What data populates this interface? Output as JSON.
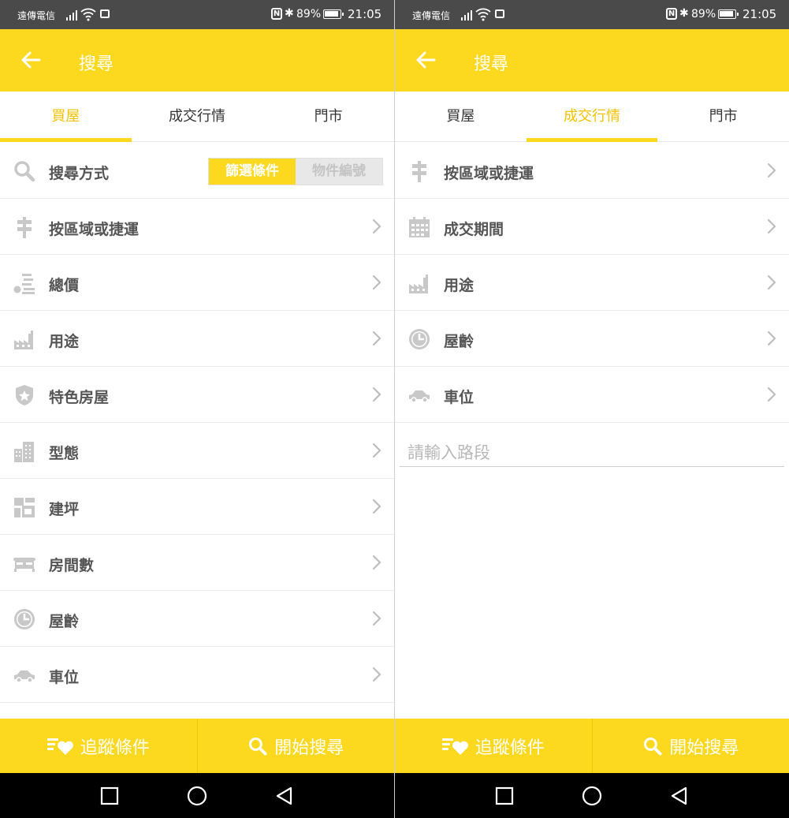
{
  "status_bar": {
    "carrier": "遠傳電信",
    "battery": "89%",
    "time": "21:05"
  },
  "colors": {
    "accent": "#fcd81f",
    "active_tab": "#f2c200",
    "icon_gray": "#c8c8c8"
  },
  "left": {
    "title": "搜尋",
    "tabs": [
      "買屋",
      "成交行情",
      "門市"
    ],
    "active_tab": 0,
    "search_method": {
      "label": "搜尋方式",
      "options": [
        "篩選條件",
        "物件編號"
      ],
      "selected": "篩選條件"
    },
    "rows": [
      {
        "label": "按區域或捷運",
        "icon": "signpost-icon"
      },
      {
        "label": "總價",
        "icon": "money-stack-icon"
      },
      {
        "label": "用途",
        "icon": "factory-icon"
      },
      {
        "label": "特色房屋",
        "icon": "shield-star-icon"
      },
      {
        "label": "型態",
        "icon": "building-icon"
      },
      {
        "label": "建坪",
        "icon": "floorplan-icon"
      },
      {
        "label": "房間數",
        "icon": "bed-icon"
      },
      {
        "label": "屋齡",
        "icon": "clock-icon"
      },
      {
        "label": "車位",
        "icon": "car-icon"
      }
    ],
    "bottom": {
      "track": "追蹤條件",
      "search": "開始搜尋"
    }
  },
  "right": {
    "title": "搜尋",
    "tabs": [
      "買屋",
      "成交行情",
      "門市"
    ],
    "active_tab": 1,
    "rows": [
      {
        "label": "按區域或捷運",
        "icon": "signpost-icon"
      },
      {
        "label": "成交期間",
        "icon": "calendar-icon"
      },
      {
        "label": "用途",
        "icon": "factory-icon"
      },
      {
        "label": "屋齡",
        "icon": "clock-icon"
      },
      {
        "label": "車位",
        "icon": "car-icon"
      }
    ],
    "road_placeholder": "請輸入路段",
    "bottom": {
      "track": "追蹤條件",
      "search": "開始搜尋"
    }
  }
}
